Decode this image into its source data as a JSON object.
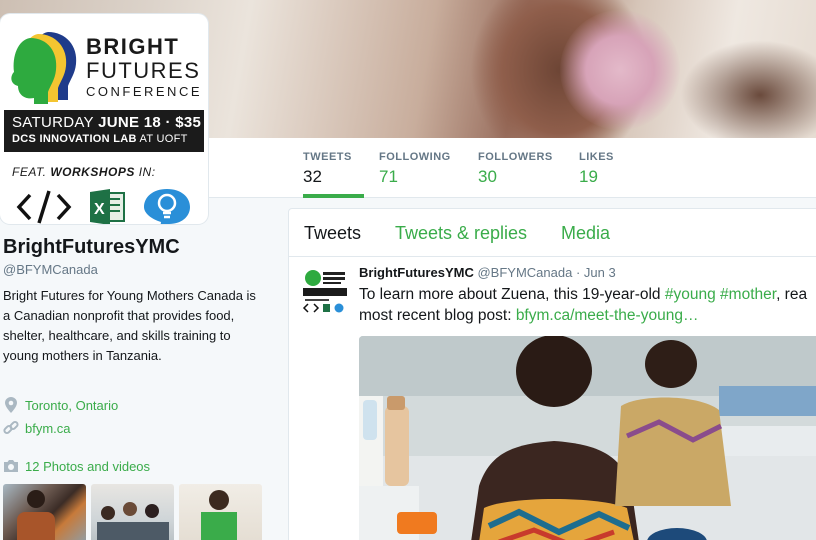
{
  "colors": {
    "accent": "#3aac4a",
    "link_blue": "#1b95e0",
    "text": "#14171a",
    "muted": "#657786"
  },
  "avatar_card": {
    "logo_line1": "BRIGHT",
    "logo_line2": "FUTURES",
    "logo_line3": "CONFERENCE",
    "date_line_prefix": "SATURDAY ",
    "date_line_bold": "JUNE 18 · $35",
    "venue_bold": "DCS INNOVATION LAB",
    "venue_rest": " AT UOFT",
    "feat_prefix": "FEAT. ",
    "feat_bold": "WORKSHOPS",
    "feat_suffix": " IN:",
    "workshop_icons": [
      "code-icon",
      "excel-icon",
      "lightbulb-icon"
    ]
  },
  "nav": {
    "items": [
      {
        "label": "TWEETS",
        "value": "32"
      },
      {
        "label": "FOLLOWING",
        "value": "71"
      },
      {
        "label": "FOLLOWERS",
        "value": "30"
      },
      {
        "label": "LIKES",
        "value": "19"
      }
    ]
  },
  "profile": {
    "name": "BrightFuturesYMC",
    "handle": "@BFYMCanada",
    "bio": "Bright Futures for Young Mothers Canada is a Canadian nonprofit that provides food, shelter, healthcare, and skills training to young mothers in Tanzania.",
    "location": "Toronto, Ontario",
    "website": "bfym.ca",
    "photos_label": "12 Photos and videos"
  },
  "timeline": {
    "tabs": [
      "Tweets",
      "Tweets & replies",
      "Media"
    ],
    "tweet": {
      "name": "BrightFuturesYMC",
      "handle": "@BFYMCanada",
      "separator": " · ",
      "date": "Jun 3",
      "text_1": "To learn more about Zuena, this 19-year-old ",
      "hashtag_1": "#young",
      "space": " ",
      "hashtag_2": "#mother",
      "text_2": ", rea",
      "text_3": "most recent blog post: ",
      "link": "bfym.ca/meet-the-young…"
    }
  }
}
